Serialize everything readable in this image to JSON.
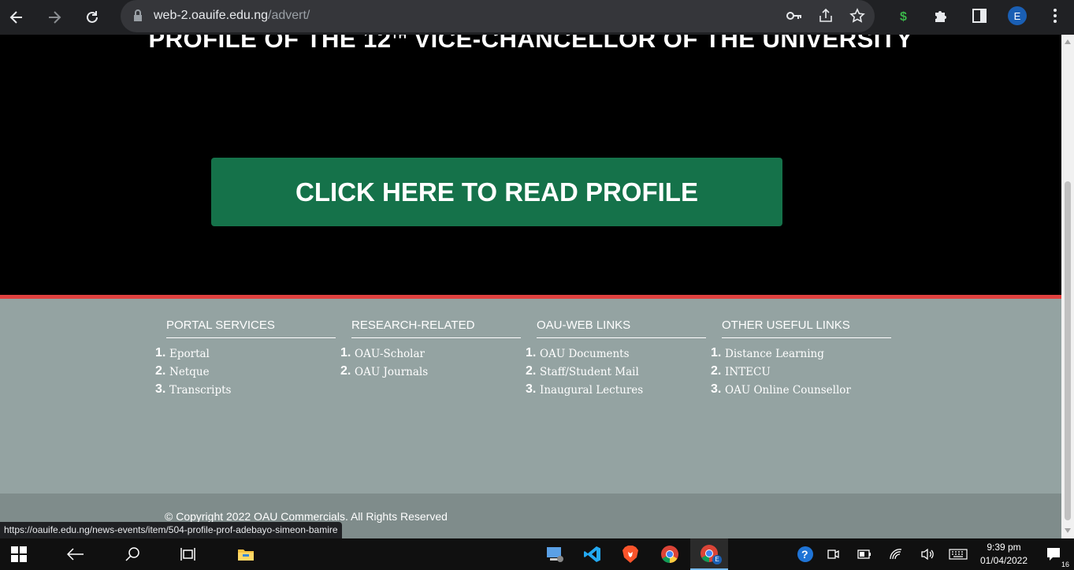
{
  "browser": {
    "url_host": "web-2.oauife.edu.ng",
    "url_path": "/advert/",
    "profile_initial": "E"
  },
  "banner": {
    "headline_pre": "PROFILE OF THE 12",
    "headline_sup": "TH",
    "headline_post": " VICE-CHANCELLOR OF THE UNIVERSITY",
    "cta_label": "CLICK HERE TO READ PROFILE"
  },
  "footer": {
    "columns": [
      {
        "title": "PORTAL SERVICES",
        "links": [
          "Eportal",
          "Netque",
          "Transcripts"
        ]
      },
      {
        "title": "RESEARCH-RELATED",
        "links": [
          "OAU-Scholar",
          "OAU Journals"
        ]
      },
      {
        "title": "OAU-WEB LINKS",
        "links": [
          "OAU Documents",
          "Staff/Student Mail",
          "Inaugural Lectures"
        ]
      },
      {
        "title": "OTHER USEFUL LINKS",
        "links": [
          "Distance Learning",
          "INTECU",
          "OAU Online Counsellor"
        ]
      }
    ],
    "copyright": "© Copyright 2022 OAU Commercials. All Rights Reserved"
  },
  "status_link": "https://oauife.edu.ng/news-events/item/504-profile-prof-adebayo-simeon-bamire",
  "taskbar": {
    "time": "9:39 pm",
    "date": "01/04/2022",
    "notification_count": "16",
    "chrome_badge": "E"
  },
  "numbers": [
    "1.",
    "2.",
    "3."
  ],
  "colors": {
    "cta_green": "#15724a",
    "footer_bg": "#94a3a2",
    "accent_red": "#e0413f"
  }
}
